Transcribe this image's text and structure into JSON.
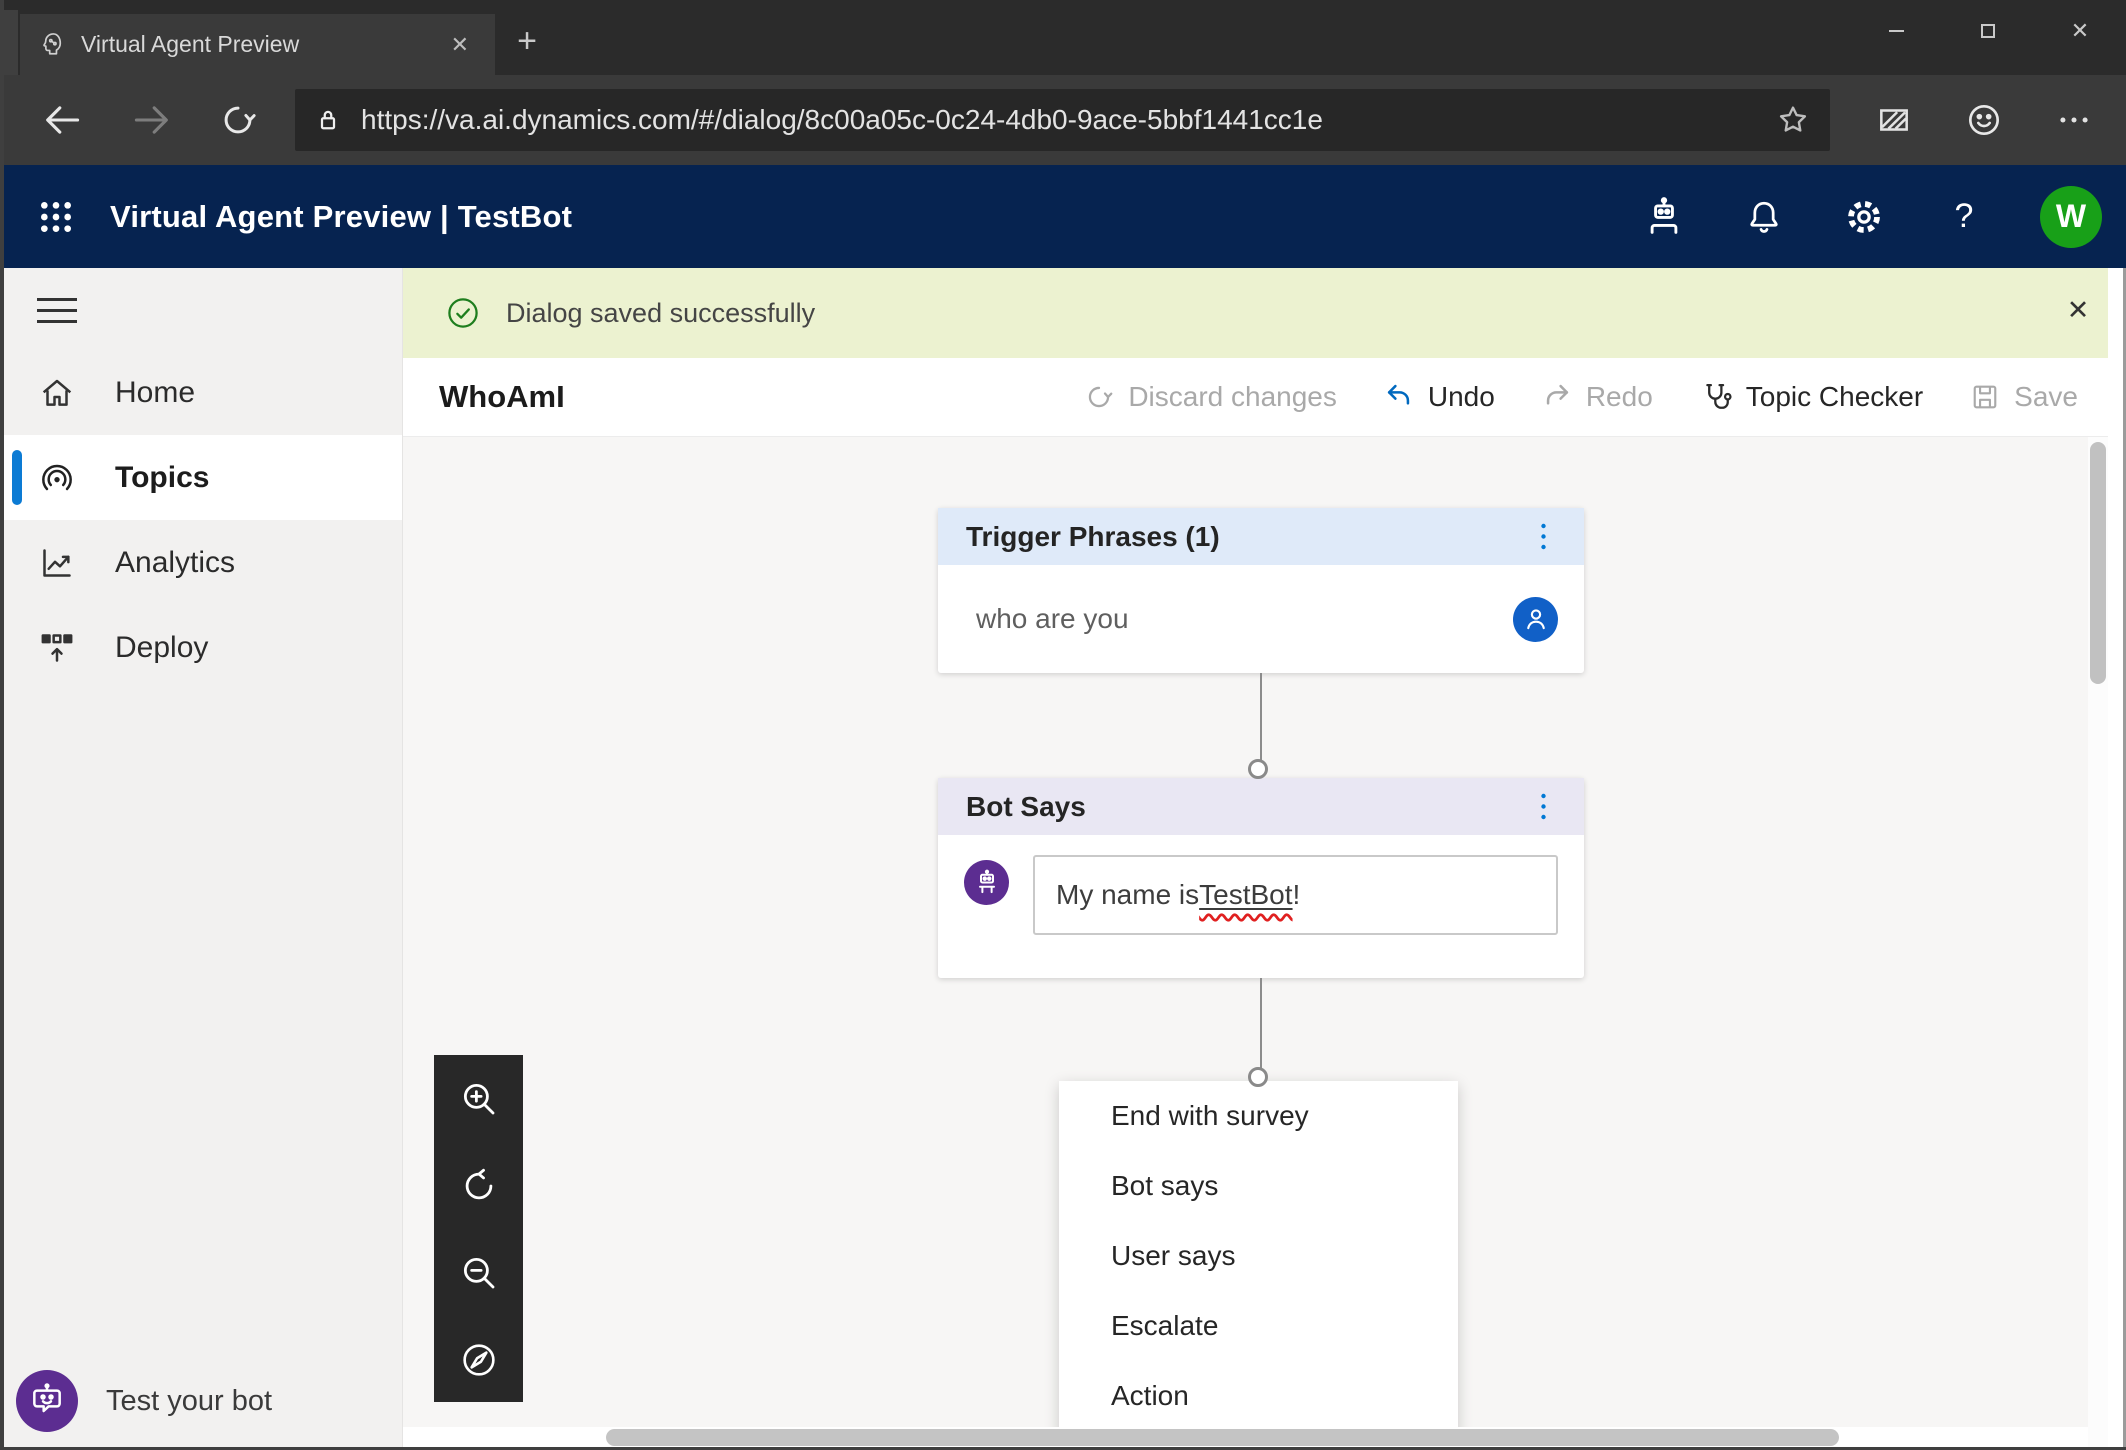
{
  "browser": {
    "tab_title": "Virtual Agent Preview",
    "url": "https://va.ai.dynamics.com/#/dialog/8c00a05c-0c24-4db0-9ace-5bbf1441cc1e"
  },
  "icons": {
    "close_glyph": "✕",
    "plus_glyph": "+",
    "help_glyph": "?"
  },
  "header": {
    "title": "Virtual Agent Preview | TestBot",
    "avatar_initial": "W"
  },
  "banner": {
    "message": "Dialog saved successfully"
  },
  "toolbar": {
    "topic_name": "WhoAmI",
    "discard": "Discard changes",
    "undo": "Undo",
    "redo": "Redo",
    "topic_checker": "Topic Checker",
    "save": "Save"
  },
  "sidebar": {
    "items": [
      {
        "label": "Home"
      },
      {
        "label": "Topics"
      },
      {
        "label": "Analytics"
      },
      {
        "label": "Deploy"
      }
    ],
    "test_bot": "Test your bot"
  },
  "canvas": {
    "trigger_node": {
      "title": "Trigger Phrases (1)",
      "phrase": "who are you"
    },
    "bot_node": {
      "title": "Bot Says",
      "msg_prefix": "My name is ",
      "msg_word": "TestBot",
      "msg_suffix": "!"
    },
    "add_menu": {
      "items": [
        "End with survey",
        "Bot says",
        "User says",
        "Escalate",
        "Action"
      ]
    }
  },
  "colors": {
    "header_bg": "#062350",
    "accent_blue": "#0078d4",
    "banner_bg": "#ecf2d0",
    "success_green": "#1e7e1e",
    "bot_purple": "#5c2d91",
    "avatar_green": "#18a018",
    "person_blue": "#1160c7",
    "trigger_header": "#dfeaf9",
    "bot_says_header": "#e9e7f3"
  }
}
